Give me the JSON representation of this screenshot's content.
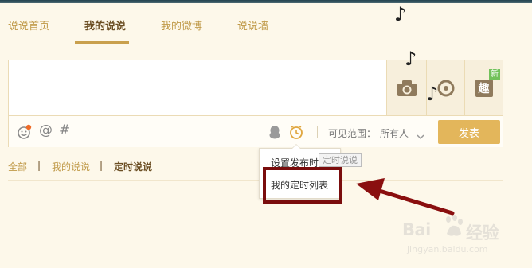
{
  "tabs": [
    {
      "label": "说说首页",
      "active": false
    },
    {
      "label": "我的说说",
      "active": true
    },
    {
      "label": "我的微博",
      "active": false
    },
    {
      "label": "说说墙",
      "active": false
    }
  ],
  "composer": {
    "text_value": "",
    "new_badge": "新",
    "fun_label": "趣",
    "at_symbol": "@",
    "hash_symbol": "#",
    "visibility_label": "可见范围：",
    "visibility_value": "所有人",
    "publish_label": "发表"
  },
  "filters": [
    {
      "label": "全部",
      "active": false
    },
    {
      "label": "我的说说",
      "active": false
    },
    {
      "label": "定时说说",
      "active": true
    }
  ],
  "filter_separator": "|",
  "popup": {
    "item1": "设置发布时间",
    "item2": "我的定时列表"
  },
  "tooltip_text": "定时说说",
  "music_note": "♪",
  "watermark": {
    "brand_left": "Bai",
    "brand_right": "经验",
    "url": "jingyan.baidu.com"
  },
  "icons": {
    "camera": "camera-icon",
    "music": "music-icon",
    "emoji": "emoji-icon",
    "qq": "qq-penguin-icon",
    "timer": "timer-icon",
    "chevron": "chevron-down-icon"
  },
  "colors": {
    "accent": "#c9a04d",
    "publish_button": "#e3b65b",
    "highlight": "#7a0d0d",
    "background": "#fdf8ea"
  }
}
